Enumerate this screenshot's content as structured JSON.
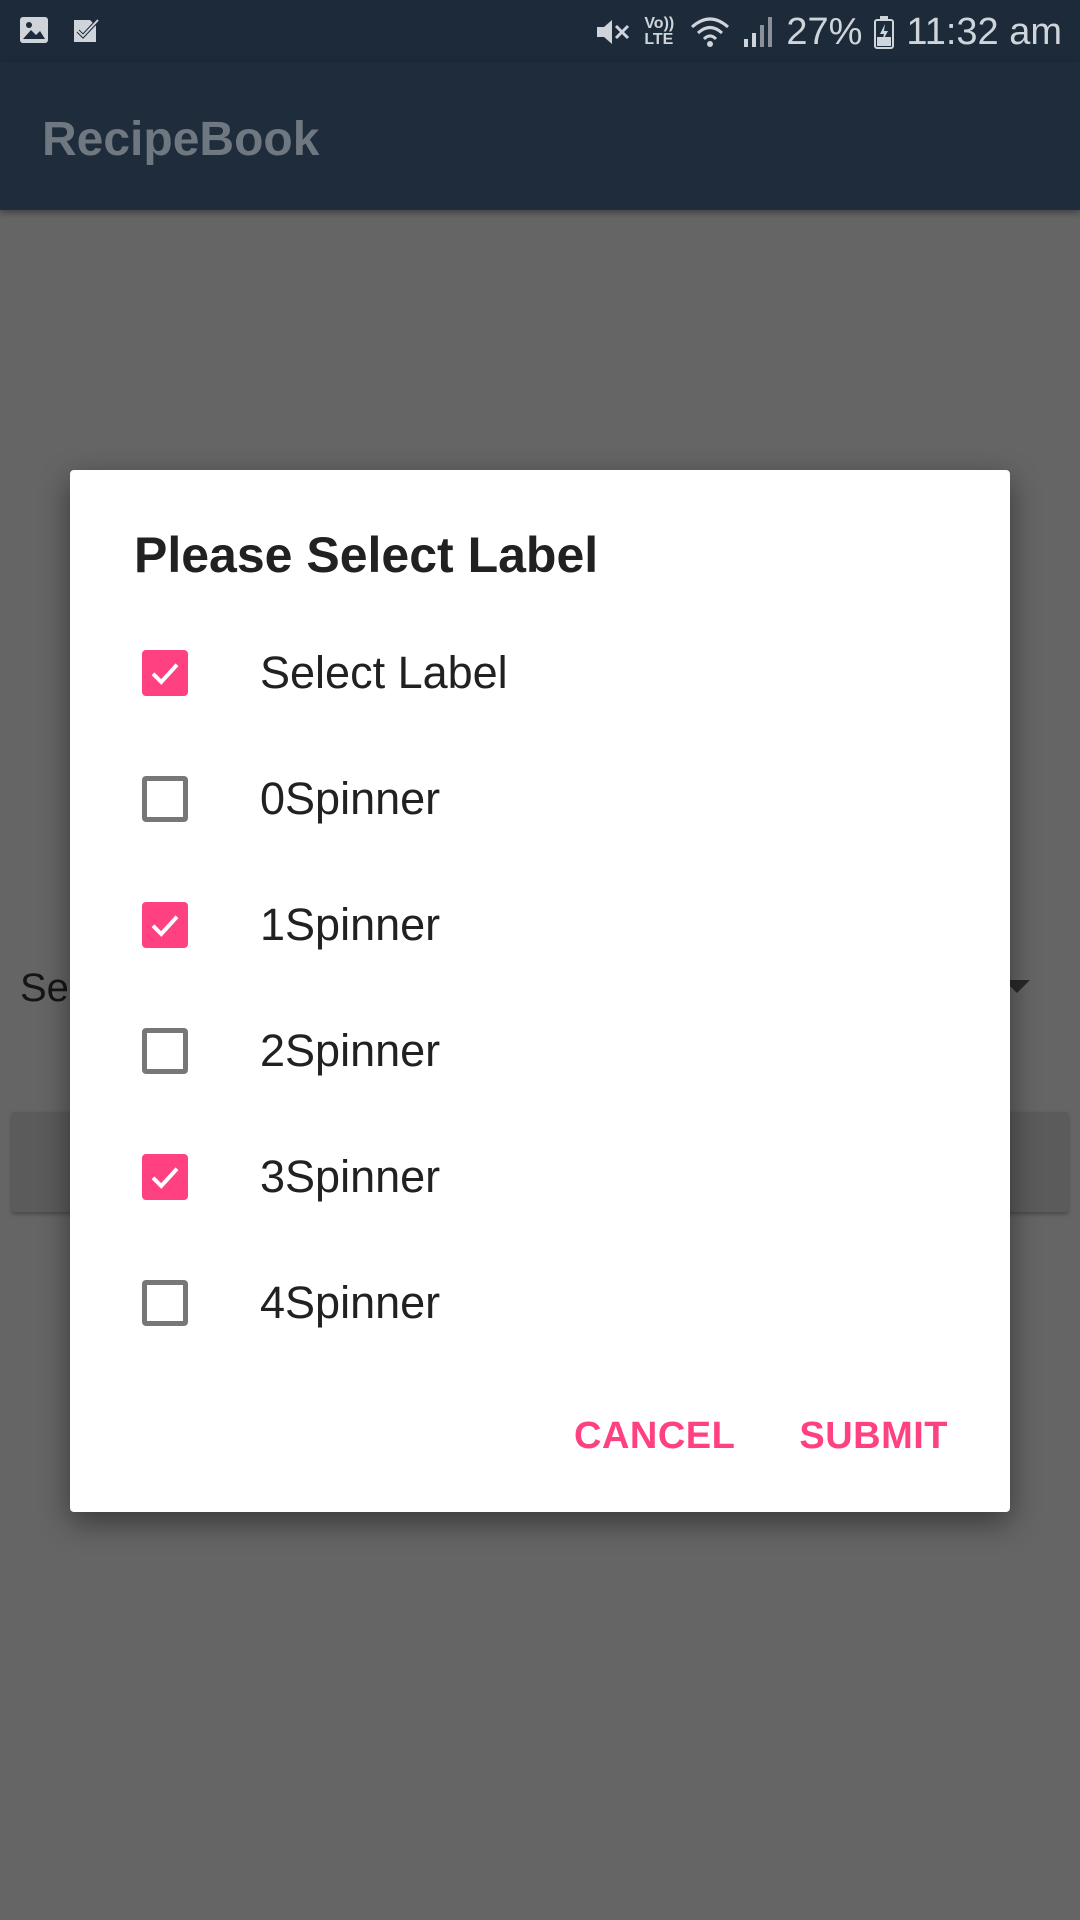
{
  "status_bar": {
    "battery": "27%",
    "time": "11:32 am",
    "volte": "Vo)) LTE",
    "icons": [
      "gallery-icon",
      "task-check-icon",
      "mute-icon",
      "volte-icon",
      "wifi-icon",
      "signal-icon",
      "battery-icon"
    ]
  },
  "app_bar": {
    "title": "RecipeBook"
  },
  "background": {
    "spinner_text": "Se"
  },
  "dialog": {
    "title": "Please Select Label",
    "options": [
      {
        "label": "Select Label",
        "checked": true
      },
      {
        "label": "0Spinner",
        "checked": false
      },
      {
        "label": "1Spinner",
        "checked": true
      },
      {
        "label": "2Spinner",
        "checked": false
      },
      {
        "label": "3Spinner",
        "checked": true
      },
      {
        "label": "4Spinner",
        "checked": false
      }
    ],
    "cancel_label": "CANCEL",
    "submit_label": "SUBMIT"
  },
  "colors": {
    "accent": "#ff4081",
    "app_bar": "#1e2c3b",
    "status_bar": "#1c2a39",
    "scrim": "#656565"
  }
}
